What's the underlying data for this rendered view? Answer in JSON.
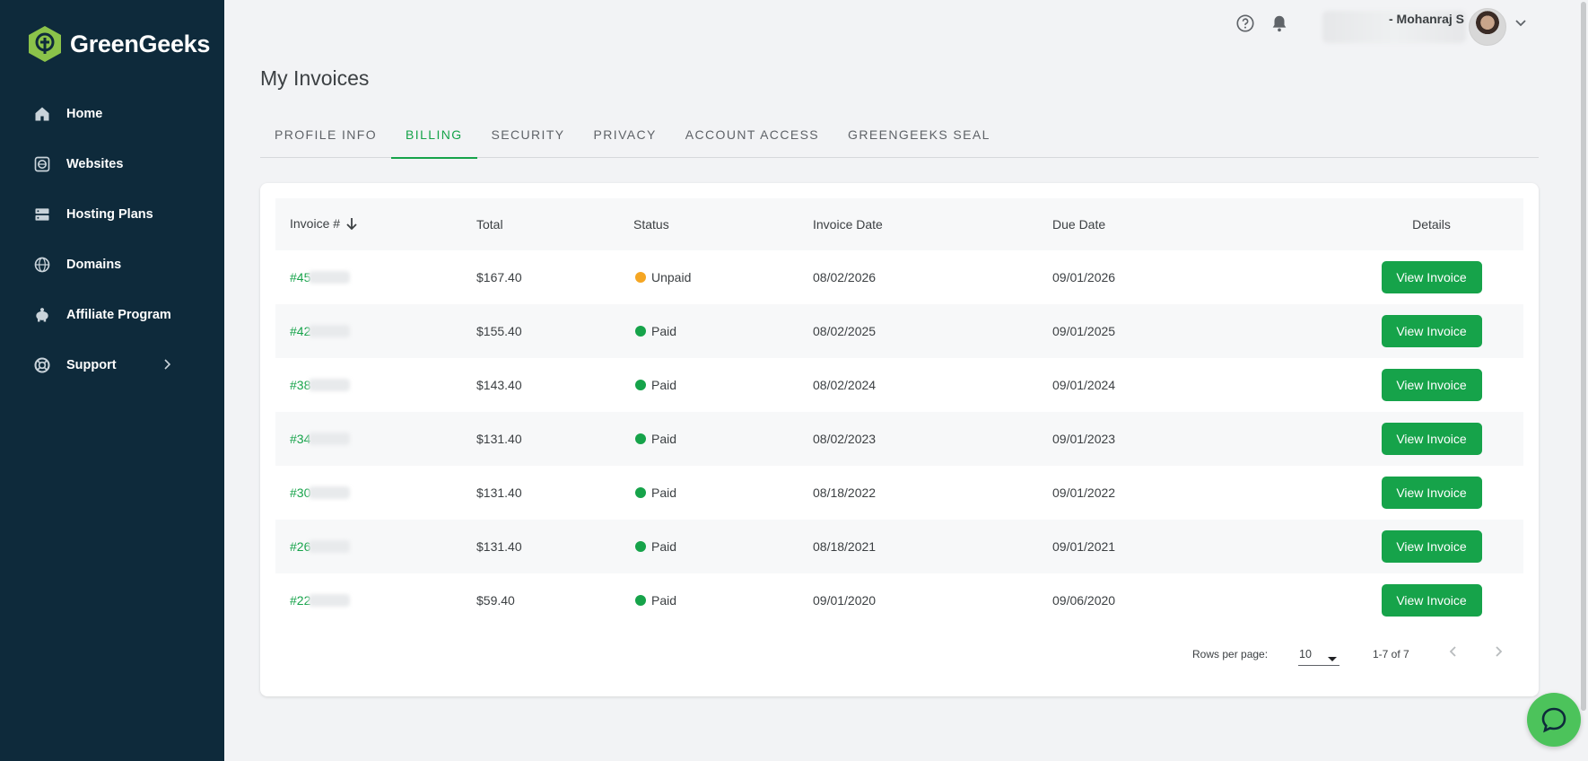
{
  "brand": {
    "name": "GreenGeeks",
    "accent": "#16a34a",
    "sidebar_bg": "#0e2a3b"
  },
  "sidebar": {
    "items": [
      {
        "label": "Home",
        "icon": "home-icon"
      },
      {
        "label": "Websites",
        "icon": "websites-icon"
      },
      {
        "label": "Hosting Plans",
        "icon": "server-icon"
      },
      {
        "label": "Domains",
        "icon": "globe-icon"
      },
      {
        "label": "Affiliate Program",
        "icon": "piggy-bank-icon"
      },
      {
        "label": "Support",
        "icon": "lifebuoy-icon"
      }
    ]
  },
  "header": {
    "user_name": "- Mohanraj S",
    "icons": [
      "help-icon",
      "bell-icon",
      "chevron-down-icon"
    ]
  },
  "page": {
    "title": "My Invoices"
  },
  "tabs": [
    {
      "label": "PROFILE INFO"
    },
    {
      "label": "BILLING"
    },
    {
      "label": "SECURITY"
    },
    {
      "label": "PRIVACY"
    },
    {
      "label": "ACCOUNT ACCESS"
    },
    {
      "label": "GREENGEEKS SEAL"
    }
  ],
  "active_tab": "BILLING",
  "table": {
    "columns": {
      "invoice": "Invoice #",
      "total": "Total",
      "status": "Status",
      "invoice_date": "Invoice Date",
      "due_date": "Due Date",
      "details": "Details"
    },
    "sort": {
      "column": "Invoice #",
      "direction": "desc"
    },
    "rows": [
      {
        "invoice": "#45",
        "total": "$167.40",
        "status": "Unpaid",
        "status_color": "#f5a623",
        "invoice_date": "08/02/2026",
        "due_date": "09/01/2026",
        "action": "View Invoice"
      },
      {
        "invoice": "#42",
        "total": "$155.40",
        "status": "Paid",
        "status_color": "#16a34a",
        "invoice_date": "08/02/2025",
        "due_date": "09/01/2025",
        "action": "View Invoice"
      },
      {
        "invoice": "#38",
        "total": "$143.40",
        "status": "Paid",
        "status_color": "#16a34a",
        "invoice_date": "08/02/2024",
        "due_date": "09/01/2024",
        "action": "View Invoice"
      },
      {
        "invoice": "#34",
        "total": "$131.40",
        "status": "Paid",
        "status_color": "#16a34a",
        "invoice_date": "08/02/2023",
        "due_date": "09/01/2023",
        "action": "View Invoice"
      },
      {
        "invoice": "#30",
        "total": "$131.40",
        "status": "Paid",
        "status_color": "#16a34a",
        "invoice_date": "08/18/2022",
        "due_date": "09/01/2022",
        "action": "View Invoice"
      },
      {
        "invoice": "#26",
        "total": "$131.40",
        "status": "Paid",
        "status_color": "#16a34a",
        "invoice_date": "08/18/2021",
        "due_date": "09/01/2021",
        "action": "View Invoice"
      },
      {
        "invoice": "#22",
        "total": "$59.40",
        "status": "Paid",
        "status_color": "#16a34a",
        "invoice_date": "09/01/2020",
        "due_date": "09/06/2020",
        "action": "View Invoice"
      }
    ]
  },
  "pagination": {
    "rows_per_page_label": "Rows per page:",
    "rows_per_page": "10",
    "range": "1-7 of 7"
  },
  "chat": {
    "icon": "chat-icon"
  }
}
